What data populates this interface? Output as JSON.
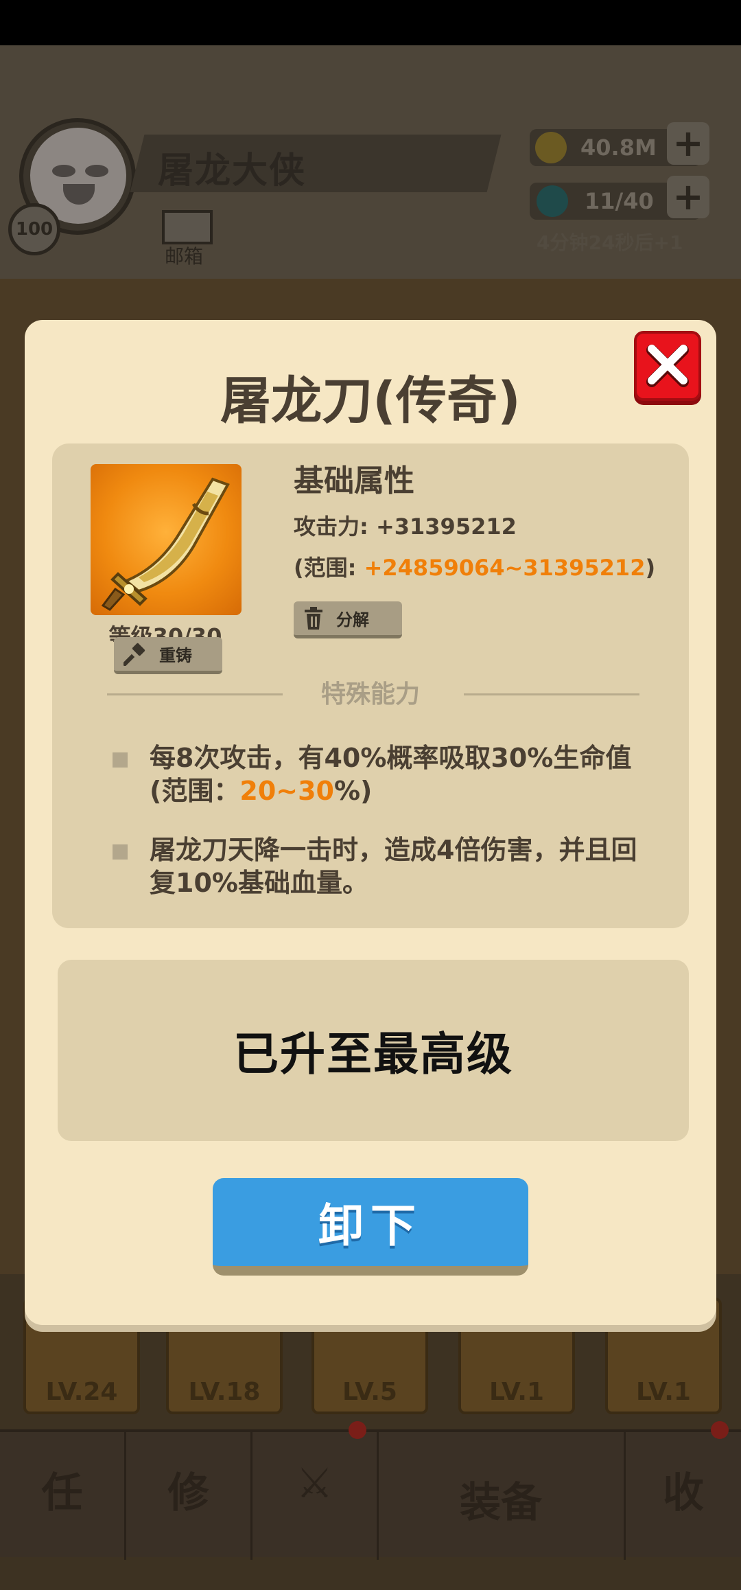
{
  "player": {
    "name": "屠龙大侠",
    "level": "100",
    "mail_label": "邮箱"
  },
  "resources": {
    "gold": "40.8M",
    "energy": "11/40",
    "regen_text": "4分钟24秒后+1"
  },
  "equipment_slots": [
    {
      "level": "LV.24"
    },
    {
      "level": "LV.18"
    },
    {
      "level": "LV.5"
    },
    {
      "level": "LV.1"
    },
    {
      "level": "LV.1"
    }
  ],
  "nav": {
    "items": [
      {
        "glyph": "任"
      },
      {
        "glyph": "修"
      },
      {
        "glyph": "⚔"
      },
      {
        "glyph": ""
      },
      {
        "glyph": "收"
      }
    ],
    "active_label": "装备"
  },
  "modal": {
    "title": "屠龙刀(传奇)",
    "item_level": "等级30/30",
    "recast_label": "重铸",
    "attr_title": "基础属性",
    "attack_line": "攻击力: +31395212",
    "range_prefix": "(范围: ",
    "range_value": "+24859064~31395212",
    "range_suffix": ")",
    "decompose_label": "分解",
    "special_title": "特殊能力",
    "ability1_part1": "每8次攻击，有40%概率吸取30%生命值(范围：",
    "ability1_value": "20~30",
    "ability1_part2": "%)",
    "ability2": "屠龙刀天降一击时，造成4倍伤害，并且回复10%基础血量。",
    "maxed_text": "已升至最高级",
    "unequip_label": "卸下"
  },
  "colors": {
    "accent_orange": "#f07f09",
    "close_red": "#e8131c",
    "button_blue": "#3a9de1",
    "panel_bg": "#f6e7c4"
  },
  "icons": {
    "item": "golden-saber-icon",
    "close": "close-x-icon",
    "recast": "hammer-icon",
    "decompose": "trash-icon"
  }
}
